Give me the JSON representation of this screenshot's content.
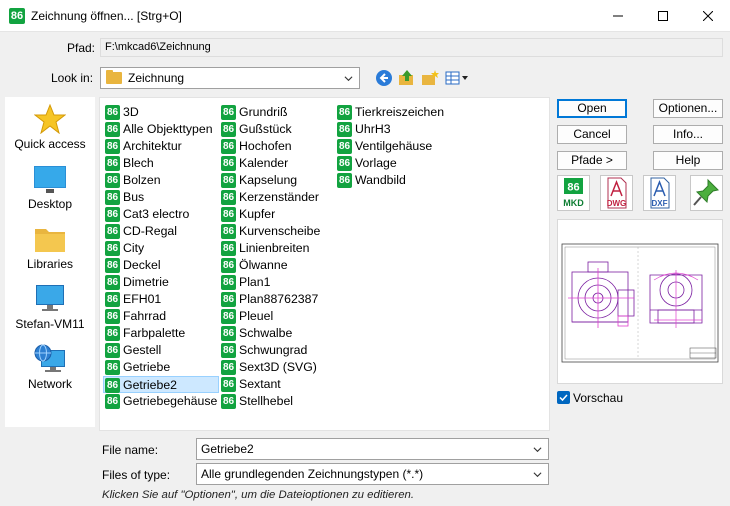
{
  "window": {
    "title": "Zeichnung öffnen... [Strg+O]",
    "app_icon_text": "86"
  },
  "path": {
    "label": "Pfad:",
    "value": "F:\\mkcad6\\Zeichnung"
  },
  "lookin": {
    "label": "Look in:",
    "value": "Zeichnung"
  },
  "places": [
    {
      "label": "Quick access",
      "icon": "star-icon"
    },
    {
      "label": "Desktop",
      "icon": "desktop-icon"
    },
    {
      "label": "Libraries",
      "icon": "folder-icon"
    },
    {
      "label": "Stefan-VM11",
      "icon": "computer-icon"
    },
    {
      "label": "Network",
      "icon": "network-icon"
    }
  ],
  "files": {
    "col1": [
      "3D",
      "Alle Objekttypen",
      "Architektur",
      "Blech",
      "Bolzen",
      "Bus",
      "Cat3 electro",
      "CD-Regal",
      "City",
      "Deckel",
      "Dimetrie",
      "EFH01",
      "Fahrrad",
      "Farbpalette",
      "Gestell",
      "Getriebe",
      "Getriebe2",
      "Getriebegehäuse"
    ],
    "col2": [
      "Grundriß",
      "Gußstück",
      "Hochofen",
      "Kalender",
      "Kapselung",
      "Kerzenständer",
      "Kupfer",
      "Kurvenscheibe",
      "Linienbreiten",
      "Ölwanne",
      "Plan1",
      "Plan88762387",
      "Pleuel",
      "Schwalbe",
      "Schwungrad",
      "Sext3D (SVG)",
      "Sextant",
      "Stellhebel"
    ],
    "col3": [
      "Tierkreiszeichen",
      "UhrH3",
      "Ventilgehäuse",
      "Vorlage",
      "Wandbild"
    ],
    "selected": "Getriebe2"
  },
  "buttons": {
    "open": "Open",
    "cancel": "Cancel",
    "paths": "Pfade >",
    "options": "Optionen...",
    "info": "Info...",
    "help": "Help"
  },
  "formats": {
    "mkd": "MKD",
    "dwg": "DWG",
    "dxf": "DXF"
  },
  "preview": {
    "checkbox_label": "Vorschau",
    "checked": true
  },
  "filename": {
    "label": "File name:",
    "value": "Getriebe2"
  },
  "filetype": {
    "label": "Files of type:",
    "value": "Alle grundlegenden Zeichnungstypen (*.*)"
  },
  "hint": "Klicken Sie auf \"Optionen\", um die Dateioptionen zu editieren.",
  "colors": {
    "accent": "#0078d7",
    "app_green": "#12a340",
    "selection": "#cde8ff"
  }
}
